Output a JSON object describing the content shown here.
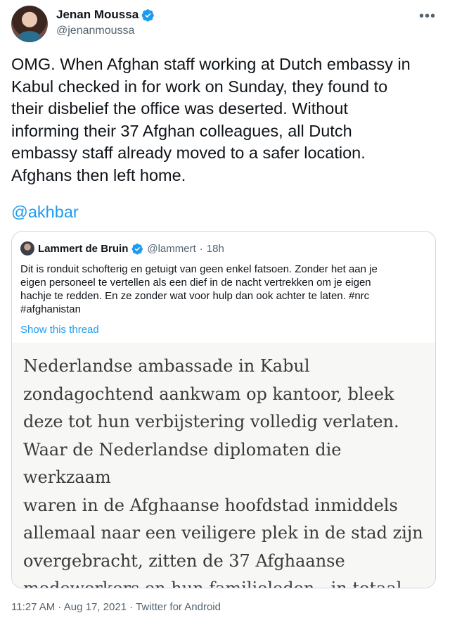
{
  "author": {
    "name": "Jenan Moussa",
    "handle": "@jenanmoussa"
  },
  "tweet": {
    "text": "OMG. When Afghan staff working at Dutch embassy in\nKabul checked in for work on Sunday, they found to\ntheir disbelief the office was deserted. Without\ninforming their 37 Afghan colleagues, all Dutch\nembassy staff already moved to a safer location.\nAfghans then left home.",
    "mention": "@akhbar"
  },
  "quoted": {
    "name": "Lammert de Bruin",
    "handle": "@lammert",
    "dot": "·",
    "time": "18h",
    "text": "Dit is ronduit schofterig en getuigt van geen enkel fatsoen. Zonder het aan je\neigen personeel te vertellen als een dief in de nacht vertrekken om je eigen\nhachje te redden. En ze zonder wat voor hulp dan ook achter te laten. #nrc\n#afghanistan",
    "show_thread": "Show this thread",
    "image_text": "Nederlandse ambassade in Kabul\nzondagochtend aankwam op kantoor, bleek\ndeze tot hun verbijstering volledig verlaten.\nWaar de Nederlandse diplomaten die werkzaam\nwaren in de Afghaanse hoofdstad inmiddels\nallemaal naar een veiligere plek in de stad zijn\novergebracht, zitten de 37 Afghaanse\nmedewerkers en hun familieleden - in totaal\nzo'n tweehonderd mensen - nog thuis in grote"
  },
  "footer": {
    "timestamp": "11:27 AM · Aug 17, 2021 · Twitter for Android"
  },
  "icons": {
    "verified": "verified-badge-icon",
    "more": "more-options-icon"
  },
  "colors": {
    "accent": "#1d9bf0",
    "text": "#0f1419",
    "secondary": "#536471",
    "border": "#cfd9de"
  }
}
